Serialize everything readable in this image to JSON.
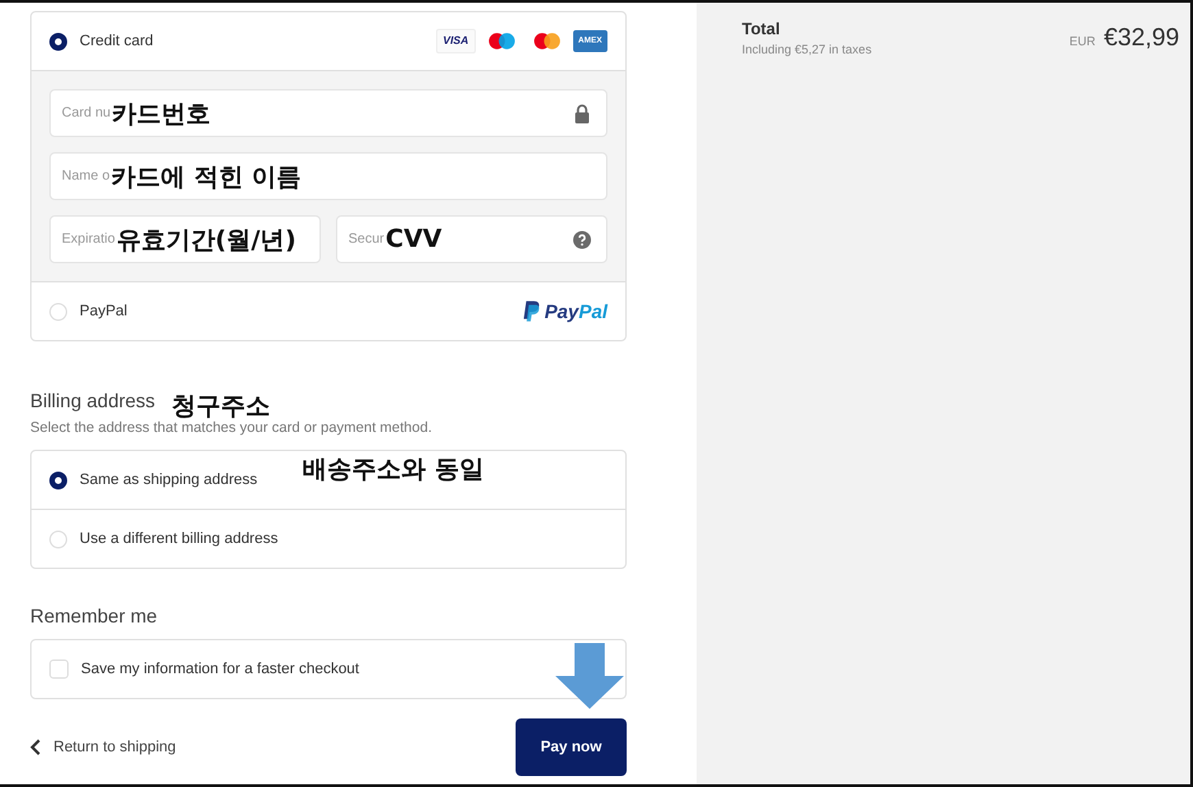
{
  "payment_methods": [
    {
      "kind": "card",
      "label": "Credit card",
      "selected": true,
      "brands": [
        {
          "kind": "visa",
          "text": "VISA"
        },
        {
          "kind": "maestro"
        },
        {
          "kind": "mastercard"
        },
        {
          "kind": "amex",
          "text": "AMEX"
        }
      ],
      "fields": [
        {
          "placeholder": "Card nu",
          "annotation": "카드번호",
          "kind": "secure"
        },
        {
          "placeholder": "Name o",
          "annotation": "카드에 적힌 이름"
        },
        {
          "placeholder": "Expiratio",
          "annotation": "유효기간(월/년)"
        },
        {
          "placeholder": "Secur",
          "annotation": "CVV",
          "kind": "help"
        }
      ]
    },
    {
      "kind": "paypal",
      "label": "PayPal",
      "selected": false,
      "logo_text": [
        "Pay",
        "Pal"
      ]
    }
  ],
  "billing": {
    "title": "Billing address",
    "annotation": "청구주소",
    "subtitle": "Select the address that matches your card or payment method.",
    "options": [
      {
        "label": "Same as shipping address",
        "selected": true,
        "annotation": "배송주소와 동일"
      },
      {
        "label": "Use a different billing address",
        "selected": false
      }
    ]
  },
  "remember": {
    "title": "Remember me",
    "label": "Save my information for a faster checkout",
    "checked": false
  },
  "footer": {
    "back": "Return to shipping",
    "pay": "Pay now"
  },
  "summary": {
    "title": "Total",
    "subtitle": "Including €5,27 in taxes",
    "currency": "EUR",
    "amount": "€32,99"
  }
}
